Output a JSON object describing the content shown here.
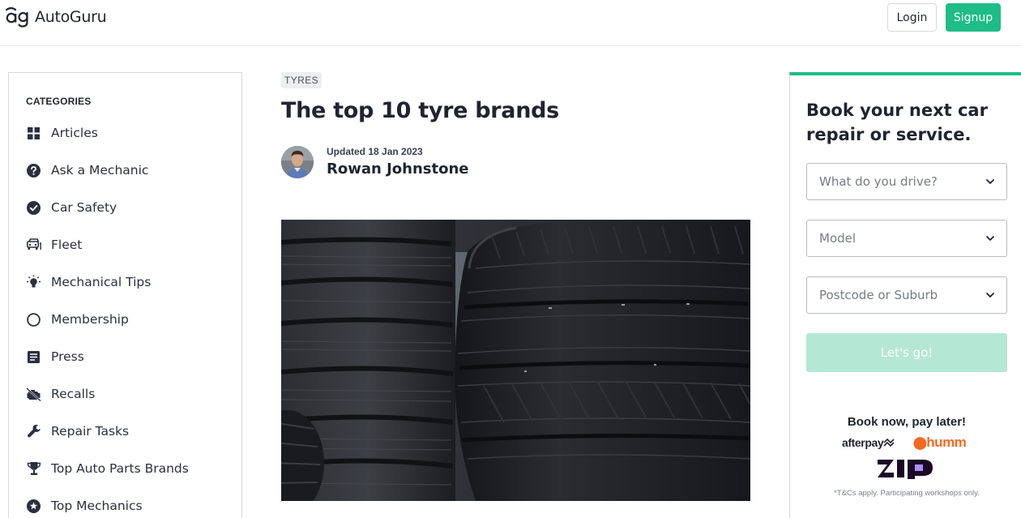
{
  "header": {
    "logo_text": "AutoGuru",
    "login_label": "Login",
    "signup_label": "Signup",
    "brand_color": "#1ebc87"
  },
  "sidebar": {
    "heading": "CATEGORIES",
    "items": [
      {
        "label": "Articles",
        "icon": "grid-icon"
      },
      {
        "label": "Ask a Mechanic",
        "icon": "question-icon"
      },
      {
        "label": "Car Safety",
        "icon": "check-circle-icon"
      },
      {
        "label": "Fleet",
        "icon": "car-icon"
      },
      {
        "label": "Mechanical Tips",
        "icon": "lightbulb-icon"
      },
      {
        "label": "Membership",
        "icon": "circle-icon"
      },
      {
        "label": "Press",
        "icon": "document-icon"
      },
      {
        "label": "Recalls",
        "icon": "engine-warning-icon"
      },
      {
        "label": "Repair Tasks",
        "icon": "wrench-icon"
      },
      {
        "label": "Top Auto Parts Brands",
        "icon": "trophy-icon"
      },
      {
        "label": "Top Mechanics",
        "icon": "star-badge-icon"
      }
    ]
  },
  "article": {
    "tag": "TYRES",
    "title": "The top 10 tyre brands",
    "updated": "Updated 18 Jan 2023",
    "author": "Rowan Johnstone"
  },
  "booking": {
    "title": "Book your next car repair or service.",
    "vehicle_placeholder": "What do you drive?",
    "model_placeholder": "Model",
    "location_placeholder": "Postcode or Suburb",
    "go_label": "Let's go!",
    "bnpl_title": "Book now, pay later!",
    "afterpay_label": "afterpay",
    "humm_label": "humm",
    "zip_label": "zip",
    "terms": "*T&Cs apply. Participating workshops only."
  }
}
